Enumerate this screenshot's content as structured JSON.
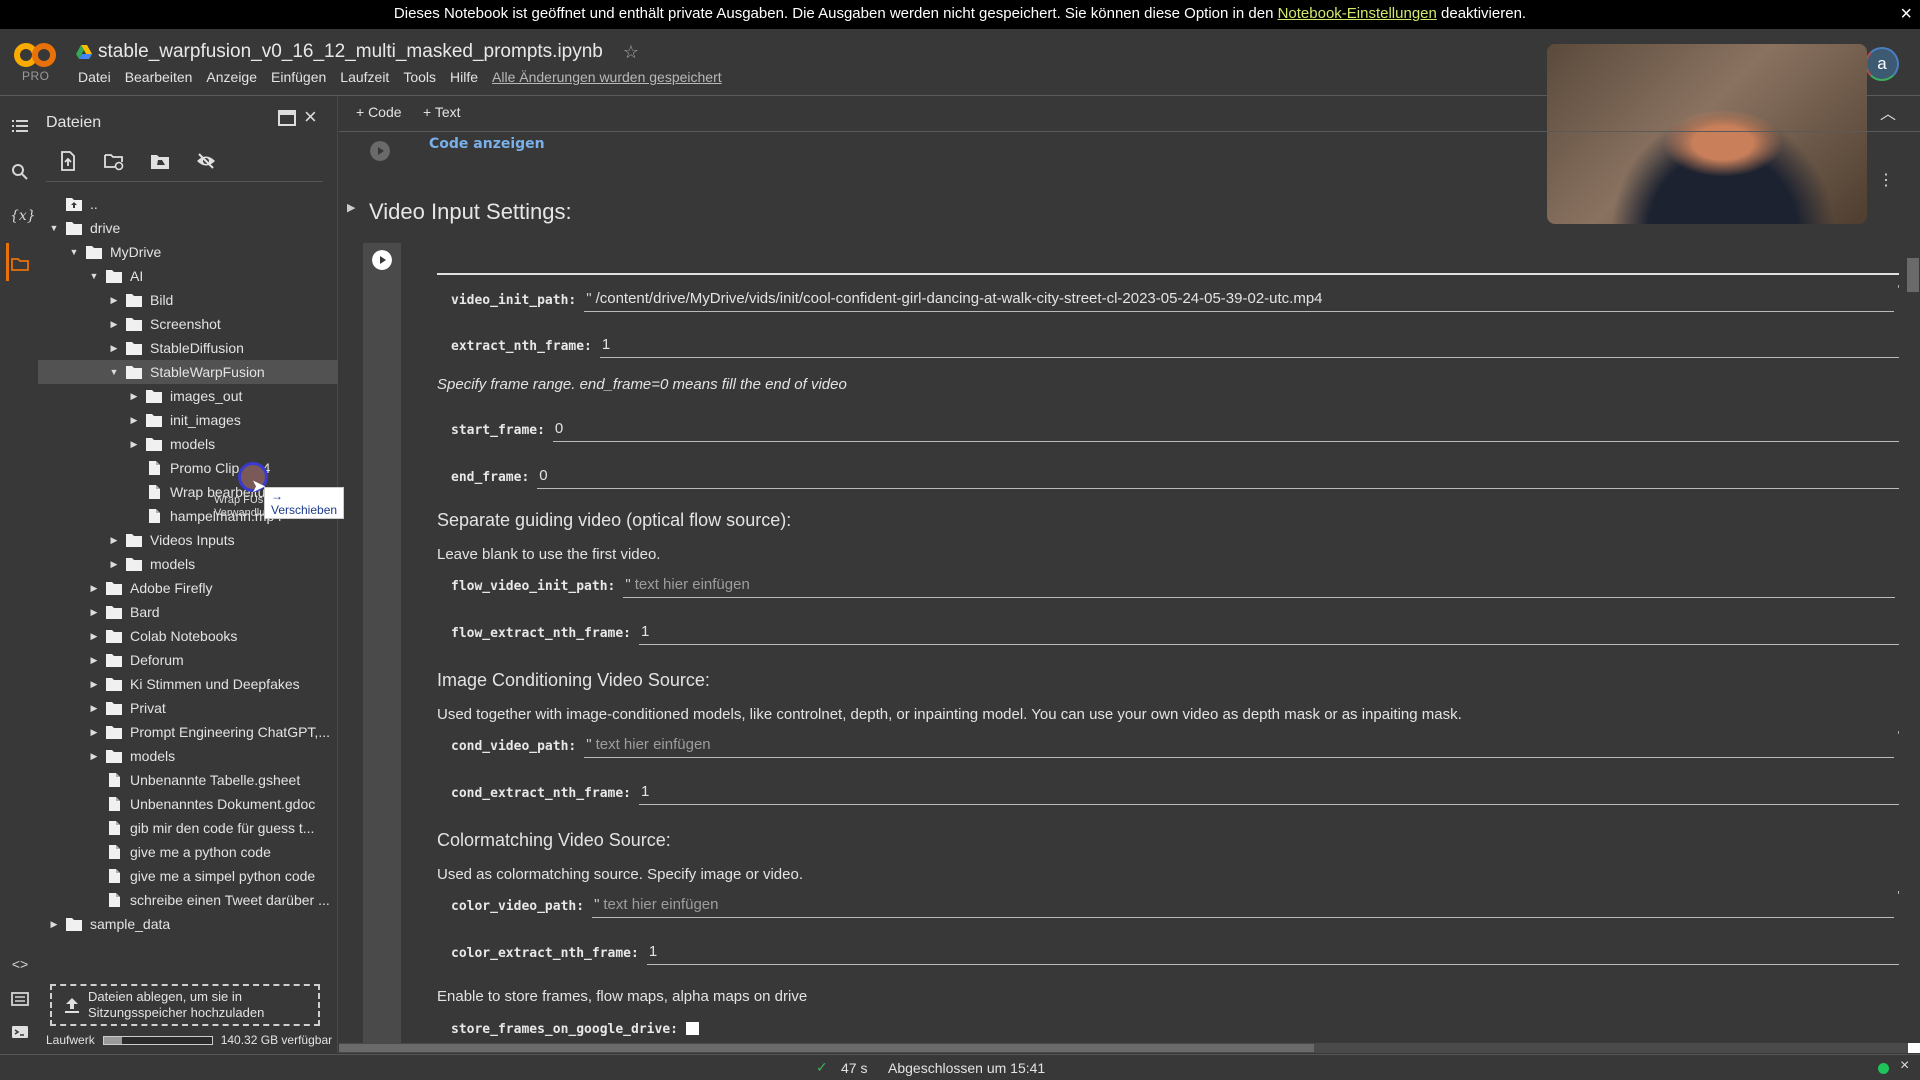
{
  "banner": {
    "text_before": "Dieses Notebook ist geöffnet und enthält private Ausgaben. Die Ausgaben werden nicht gespeichert. Sie können diese Option in den ",
    "link": "Notebook-Einstellungen",
    "text_after": " deaktivieren.",
    "close_icon": "×"
  },
  "header": {
    "logo_text": "PRO",
    "title": "stable_warpfusion_v0_16_12_multi_masked_prompts.ipynb",
    "star_icon": "☆",
    "menu": [
      "Datei",
      "Bearbeiten",
      "Anzeige",
      "Einfügen",
      "Laufzeit",
      "Tools",
      "Hilfe"
    ],
    "saved_note": "Alle Änderungen wurden gespeichert",
    "avatar_letter": "a",
    "colors": {
      "logo_orange": "#f9ab00",
      "accent_orange": "#e8710a"
    }
  },
  "rail": {
    "icons": [
      "toc-icon",
      "search-icon",
      "variables-icon",
      "folder-icon",
      "code-snippets-icon",
      "command-palette-icon",
      "terminal-icon"
    ],
    "variables_glyph": "{x}",
    "code_glyph": "<>"
  },
  "files": {
    "title": "Dateien",
    "close_icon": "×",
    "tree": [
      {
        "label": "..",
        "depth": 0,
        "type": "up",
        "caret": ""
      },
      {
        "label": "drive",
        "depth": 0,
        "type": "folder",
        "caret": "▼"
      },
      {
        "label": "MyDrive",
        "depth": 1,
        "type": "folder",
        "caret": "▼"
      },
      {
        "label": "AI",
        "depth": 2,
        "type": "folder",
        "caret": "▼"
      },
      {
        "label": "Bild",
        "depth": 3,
        "type": "folder",
        "caret": "▶"
      },
      {
        "label": "Screenshot",
        "depth": 3,
        "type": "folder",
        "caret": "▶"
      },
      {
        "label": "StableDiffusion",
        "depth": 3,
        "type": "folder",
        "caret": "▶"
      },
      {
        "label": "StableWarpFusion",
        "depth": 3,
        "type": "folder",
        "caret": "▼",
        "selected": true
      },
      {
        "label": "images_out",
        "depth": 4,
        "type": "folder",
        "caret": "▶"
      },
      {
        "label": "init_images",
        "depth": 4,
        "type": "folder",
        "caret": "▶"
      },
      {
        "label": "models",
        "depth": 4,
        "type": "folder",
        "caret": "▶"
      },
      {
        "label": "Promo Clip.mp4",
        "depth": 4,
        "type": "file",
        "caret": ""
      },
      {
        "label": "Wrap bearbeitung 2....",
        "depth": 4,
        "type": "file",
        "caret": ""
      },
      {
        "label": "hampelmann.mp4",
        "depth": 4,
        "type": "file",
        "caret": ""
      },
      {
        "label": "Videos Inputs",
        "depth": 3,
        "type": "folder",
        "caret": "▶"
      },
      {
        "label": "models",
        "depth": 3,
        "type": "folder",
        "caret": "▶"
      },
      {
        "label": "Adobe Firefly",
        "depth": 2,
        "type": "folder",
        "caret": "▶"
      },
      {
        "label": "Bard",
        "depth": 2,
        "type": "folder",
        "caret": "▶"
      },
      {
        "label": "Colab Notebooks",
        "depth": 2,
        "type": "folder",
        "caret": "▶"
      },
      {
        "label": "Deforum",
        "depth": 2,
        "type": "folder",
        "caret": "▶"
      },
      {
        "label": "Ki Stimmen und Deepfakes",
        "depth": 2,
        "type": "folder",
        "caret": "▶"
      },
      {
        "label": "Privat",
        "depth": 2,
        "type": "folder",
        "caret": "▶"
      },
      {
        "label": "Prompt Engineering ChatGPT,...",
        "depth": 2,
        "type": "folder",
        "caret": "▶"
      },
      {
        "label": "models",
        "depth": 2,
        "type": "folder",
        "caret": "▶"
      },
      {
        "label": "Unbenannte Tabelle.gsheet",
        "depth": 2,
        "type": "file",
        "caret": ""
      },
      {
        "label": "Unbenanntes Dokument.gdoc",
        "depth": 2,
        "type": "file",
        "caret": ""
      },
      {
        "label": "gib mir den code für guess t...",
        "depth": 2,
        "type": "file",
        "caret": ""
      },
      {
        "label": "give me a python code",
        "depth": 2,
        "type": "file",
        "caret": ""
      },
      {
        "label": "give me a simpel python code",
        "depth": 2,
        "type": "file",
        "caret": ""
      },
      {
        "label": "schreibe einen Tweet darüber ...",
        "depth": 2,
        "type": "file",
        "caret": ""
      },
      {
        "label": "sample_data",
        "depth": 0,
        "type": "folder",
        "caret": "▶"
      }
    ],
    "drag": {
      "ghost_label_1": "Wrap FUs",
      "ghost_label_2": "Verwandlung",
      "tooltip": "→ Verschieben"
    },
    "drop_zone": {
      "line1": "Dateien ablegen, um sie in",
      "line2": "Sitzungsspeicher hochzuladen"
    },
    "disk": {
      "label": "Laufwerk",
      "available": "140.32 GB verfügbar",
      "used_fraction": 0.17
    }
  },
  "notebook": {
    "add_code": "+ Code",
    "add_text": "+ Text",
    "show_code": "Code anzeigen",
    "section_title": "Video Input Settings:",
    "fields": {
      "video_init_path": {
        "label": "video_init_path:",
        "value": "/content/drive/MyDrive/vids/init/cool-confident-girl-dancing-at-walk-city-street-cl-2023-05-24-05-39-02-utc.mp4"
      },
      "extract_nth_frame": {
        "label": "extract_nth_frame:",
        "value": "1"
      },
      "frame_range_note": "Specify frame range. end_frame=0 means fill the end of video",
      "start_frame": {
        "label": "start_frame:",
        "value": "0"
      },
      "end_frame": {
        "label": "end_frame:",
        "value": "0"
      },
      "flow_heading": "Separate guiding video (optical flow source):",
      "flow_note": "Leave blank to use the first video.",
      "flow_video_init_path": {
        "label": "flow_video_init_path:",
        "placeholder": "text hier einfügen"
      },
      "flow_extract_nth_frame": {
        "label": "flow_extract_nth_frame:",
        "value": "1"
      },
      "cond_heading": "Image Conditioning Video Source:",
      "cond_note": "Used together with image-conditioned models, like controlnet, depth, or inpainting model. You can use your own video as depth mask or as inpaiting mask.",
      "cond_video_path": {
        "label": "cond_video_path:",
        "placeholder": "text hier einfügen"
      },
      "cond_extract_nth_frame": {
        "label": "cond_extract_nth_frame:",
        "value": "1"
      },
      "color_heading": "Colormatching Video Source:",
      "color_note": "Used as colormatching source. Specify image or video.",
      "color_video_path": {
        "label": "color_video_path:",
        "placeholder": "text hier einfügen"
      },
      "color_extract_nth_frame": {
        "label": "color_extract_nth_frame:",
        "value": "1"
      },
      "store_note": "Enable to store frames, flow maps, alpha maps on drive",
      "store_frames_on_google_drive": {
        "label": "store_frames_on_google_drive:",
        "checked": false
      }
    }
  },
  "status": {
    "check_icon": "✓",
    "duration": "47 s",
    "completed": "Abgeschlossen um 15:41",
    "connected_color": "#1ec35a",
    "close_icon": "×"
  }
}
